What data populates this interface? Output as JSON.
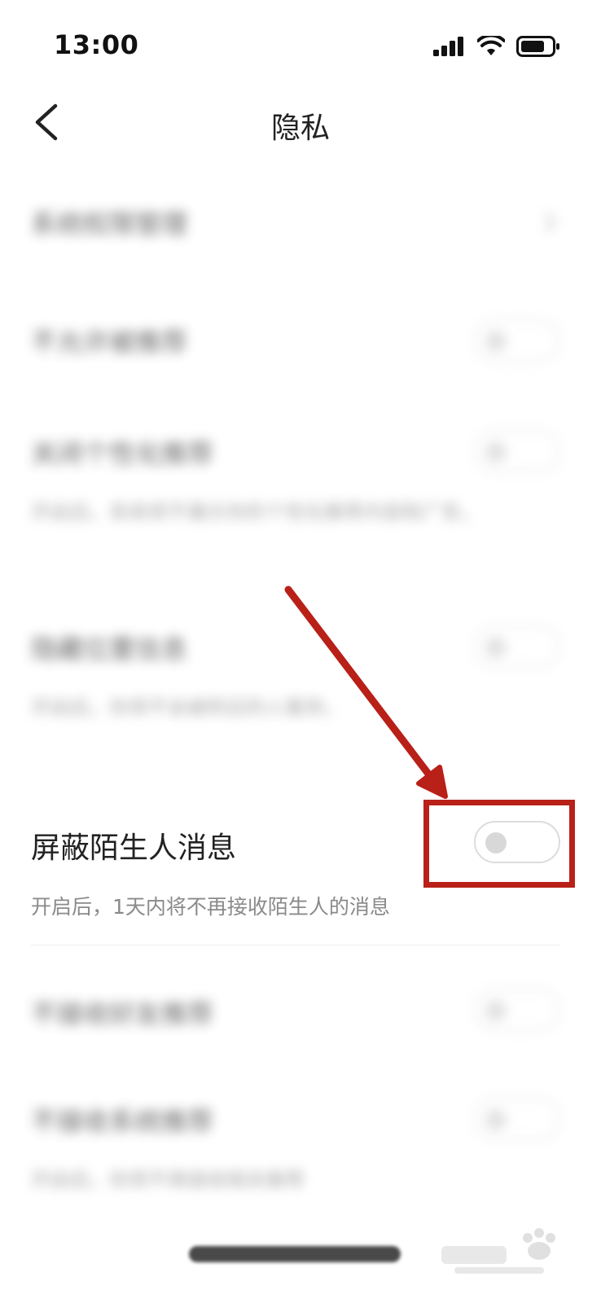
{
  "status_bar": {
    "time": "13:00"
  },
  "nav": {
    "title": "隐私"
  },
  "blurred_rows": [
    {
      "title": "系统权限管理"
    },
    {
      "title": "不允许被推荐"
    },
    {
      "title": "关闭个性化推荐",
      "desc": "开启后，系统将不展示你的个性化推荐内容和广告，"
    },
    {
      "title": "隐藏位置信息",
      "desc": "开启后，你将不会被附近的人看到，"
    },
    {
      "title": "屏蔽陌生人消息",
      "desc": "开启后，1天内将不再接收陌生人的消息"
    },
    {
      "title": "不接收好友推荐"
    },
    {
      "title": "不接收系统推荐",
      "desc": "开启后，你将不再接收相关推荐"
    }
  ],
  "focus_row": {
    "title": "屏蔽陌生人消息",
    "desc": "开启后，1天内将不再接收陌生人的消息",
    "toggle_on": false
  },
  "colors": {
    "annotation": "#b82018",
    "toggle_border": "#dcdcdc",
    "toggle_knob": "#d8d8d8"
  },
  "watermark_icon": "baidu-jingyan-watermark"
}
